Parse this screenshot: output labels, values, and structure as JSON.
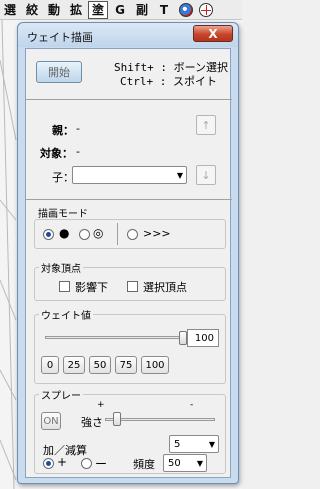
{
  "toolbar": {
    "items": [
      "選",
      "絞",
      "動",
      "拡",
      "塗",
      "G",
      "副",
      "T"
    ]
  },
  "window": {
    "title": "ウェイト描画",
    "close_label": "X"
  },
  "header": {
    "start_label": "開始",
    "shortcut_shift": "Shift+ : ボーン選択",
    "shortcut_ctrl": "Ctrl+ : スポイト"
  },
  "bones": {
    "parent_label": "親：",
    "parent_value": "-",
    "target_label": "対象：",
    "target_value": "-",
    "child_label": "子：",
    "child_value": "",
    "up_arrow": "↑",
    "down_arrow": "↓"
  },
  "draw_mode": {
    "title": "描画モード",
    "more_label": ">>>"
  },
  "target_vertex": {
    "title": "対象頂点",
    "affected_label": "影響下",
    "affected_checked": false,
    "selected_label": "選択頂点",
    "selected_checked": false
  },
  "weight": {
    "title": "ウェイト値",
    "value": "100",
    "slider_fraction": 1.0,
    "presets": [
      "0",
      "25",
      "50",
      "75",
      "100"
    ]
  },
  "spray": {
    "title": "スプレー",
    "on_label": "ON",
    "strength_label": "強さ",
    "plus_mark": "+",
    "minus_mark": "-",
    "strength_value": "5",
    "addsub_label": "加／減算",
    "add_label": "+",
    "sub_label": "ー",
    "mode": "add",
    "frequency_label": "頻度",
    "frequency_value": "50"
  },
  "colors": {
    "titlebar": "#c9dcef",
    "close": "#c9452a",
    "radio_dot": "#1d4c9c"
  }
}
